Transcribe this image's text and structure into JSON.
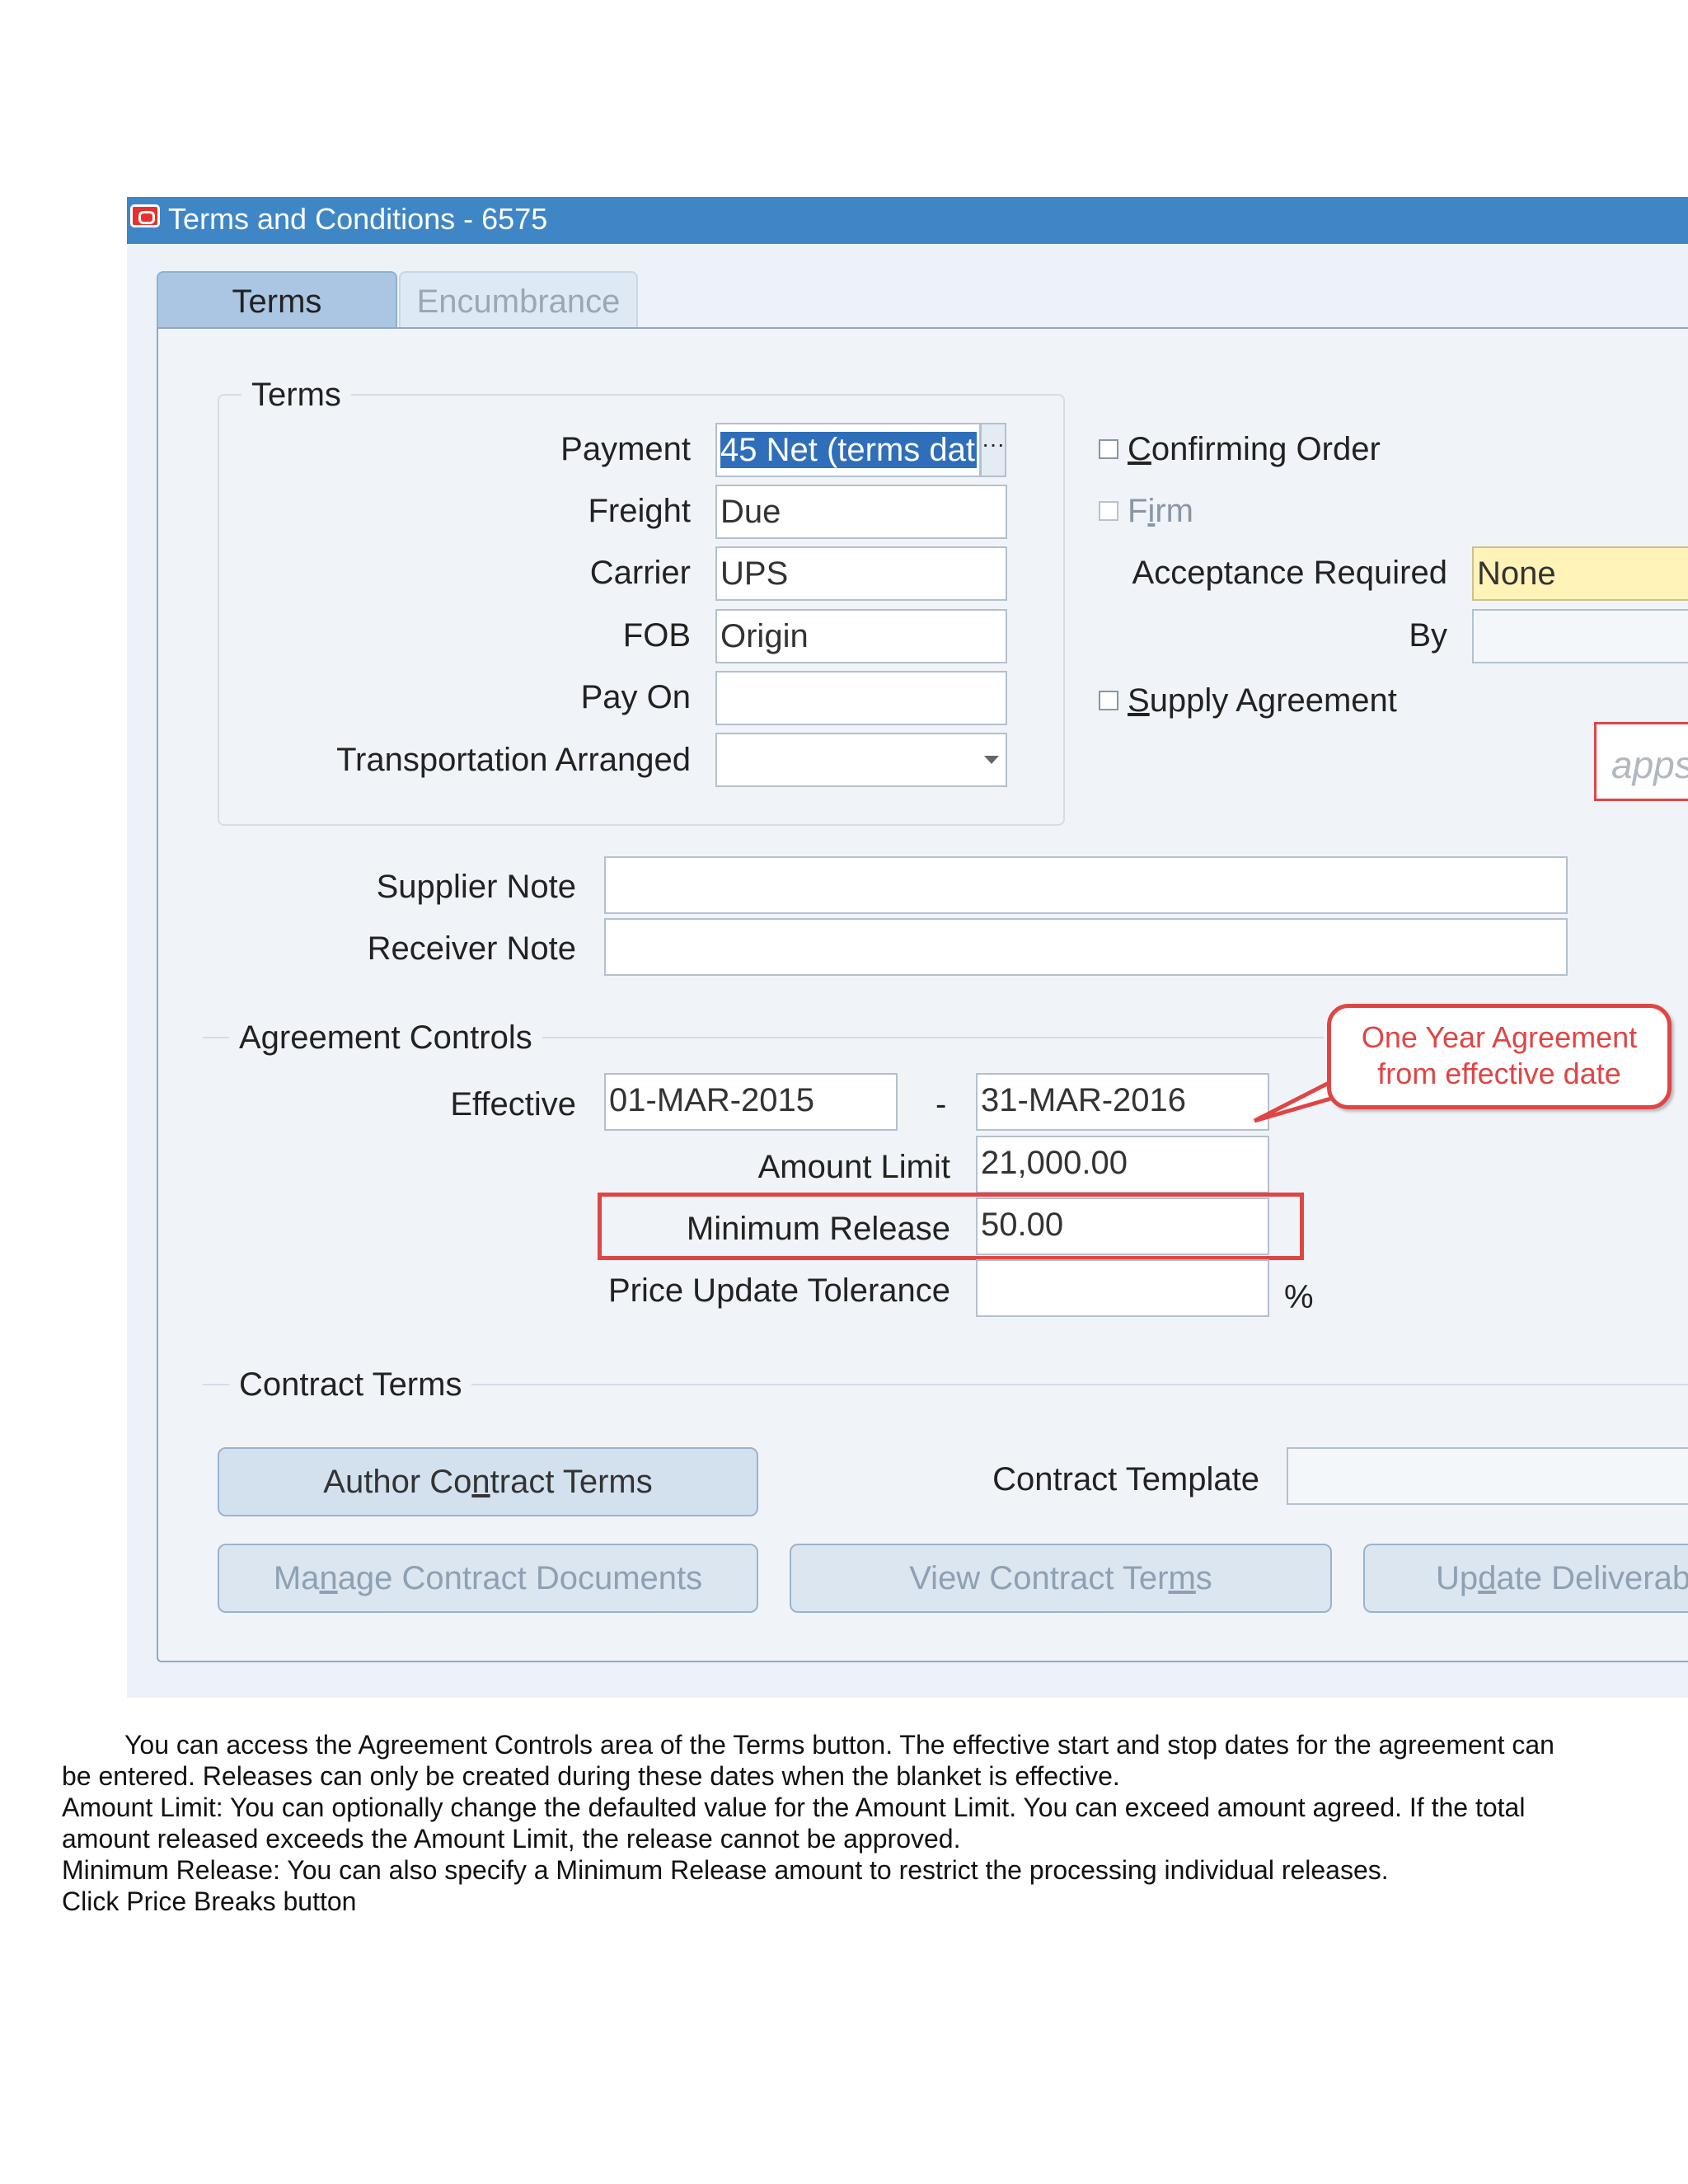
{
  "window": {
    "title": "Terms and Conditions - 6575"
  },
  "tabs": [
    {
      "label": "Terms",
      "active": true
    },
    {
      "label": "Encumbrance",
      "active": false
    }
  ],
  "terms_group": {
    "label": "Terms",
    "payment": {
      "label": "Payment",
      "value": "45 Net (terms dat"
    },
    "freight": {
      "label": "Freight",
      "value": "Due"
    },
    "carrier": {
      "label": "Carrier",
      "value": "UPS"
    },
    "fob": {
      "label": "FOB",
      "value": "Origin"
    },
    "pay_on": {
      "label": "Pay On",
      "value": ""
    },
    "transportation_arranged": {
      "label": "Transportation Arranged",
      "value": ""
    }
  },
  "right_options": {
    "confirming_order": {
      "label": "Confirming Order",
      "mnemonic": "C",
      "rest": "onfirming Order",
      "checked": false
    },
    "firm": {
      "label": "Firm",
      "pre": "F",
      "mnemonic": "i",
      "rest": "rm",
      "checked": false,
      "disabled": true
    },
    "acceptance_required": {
      "label": "Acceptance Required",
      "value": "None"
    },
    "by": {
      "label": "By",
      "value": ""
    },
    "supply_agreement": {
      "label": "Supply Agreement",
      "mnemonic": "S",
      "rest": "upply Agreement",
      "checked": false
    }
  },
  "notes": {
    "supplier_note": {
      "label": "Supplier Note",
      "value": ""
    },
    "receiver_note": {
      "label": "Receiver Note",
      "value": ""
    }
  },
  "agreement_controls": {
    "label": "Agreement Controls",
    "effective_label": "Effective",
    "effective_from": "01-MAR-2015",
    "separator": "-",
    "effective_to": "31-MAR-2016",
    "amount_limit": {
      "label": "Amount Limit",
      "value": "21,000.00"
    },
    "minimum_release": {
      "label": "Minimum Release",
      "value": "50.00"
    },
    "price_update_tolerance": {
      "label": "Price Update Tolerance",
      "value": "",
      "unit": "%"
    }
  },
  "contract_terms": {
    "label": "Contract Terms",
    "author_button": {
      "pre": "Author Co",
      "mnemonic": "n",
      "rest": "tract Terms"
    },
    "contract_template": {
      "label": "Contract Template",
      "value": ""
    },
    "manage_button": {
      "pre": "Ma",
      "mnemonic": "n",
      "rest": "age Contract Documents"
    },
    "view_button": {
      "pre": "View Contract Ter",
      "mnemonic": "m",
      "rest": "s"
    },
    "update_button": {
      "pre": "Up",
      "mnemonic": "d",
      "rest": "ate Deliverab"
    }
  },
  "annotation": {
    "line1": "One Year Agreement",
    "line2": "from effective date"
  },
  "logo_text": "apps",
  "caption": {
    "p1": "You can access the Agreement Controls area of the Terms button. The effective start and stop dates for the agreement can",
    "p1b": "be entered. Releases can only be created during these dates when the blanket is effective.",
    "p2": "Amount Limit: You can optionally change the defaulted value for the Amount Limit. You can exceed amount agreed. If the total",
    "p2b": "amount released exceeds the Amount Limit, the release cannot be approved.",
    "p3": "Minimum Release: You can also specify a Minimum Release amount to restrict the processing individual releases.",
    "p4": "Click Price Breaks button"
  },
  "colors": {
    "titlebar": "#3f86c7",
    "annotation_red": "#e04545",
    "required_yellow": "#fff3b8"
  }
}
